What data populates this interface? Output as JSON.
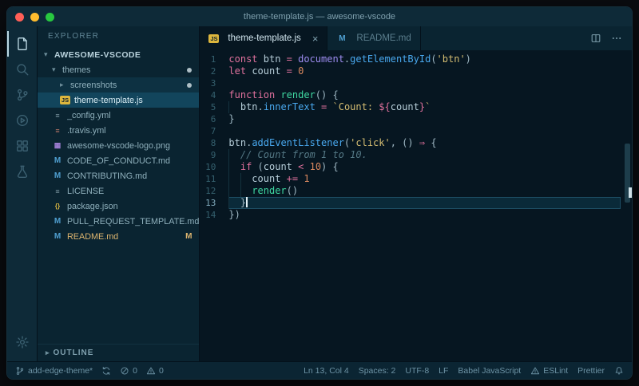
{
  "window": {
    "title": "theme-template.js — awesome-vscode",
    "traffic_lights": [
      "#ff5f57",
      "#febc2e",
      "#28c840"
    ]
  },
  "activity_bar": {
    "items": [
      {
        "name": "explorer",
        "active": true
      },
      {
        "name": "search"
      },
      {
        "name": "source-control"
      },
      {
        "name": "run"
      },
      {
        "name": "extensions"
      },
      {
        "name": "testing"
      }
    ],
    "bottom": [
      {
        "name": "settings"
      }
    ]
  },
  "sidebar": {
    "header": "EXPLORER",
    "outline_label": "OUTLINE",
    "tree": [
      {
        "label": "AWESOME-VSCODE",
        "indent": 0,
        "chevron": "down",
        "root": true
      },
      {
        "label": "themes",
        "indent": 1,
        "chevron": "down",
        "dot": true
      },
      {
        "label": "screenshots",
        "indent": 2,
        "chevron": "right",
        "dot": true,
        "state": "focused"
      },
      {
        "label": "theme-template.js",
        "indent": 2,
        "icon": "js",
        "state": "selected"
      },
      {
        "label": "_config.yml",
        "indent": 1,
        "icon": "yaml"
      },
      {
        "label": ".travis.yml",
        "indent": 1,
        "icon": "yaml",
        "icon_color": "#c07a6a"
      },
      {
        "label": "awesome-vscode-logo.png",
        "indent": 1,
        "icon": "image"
      },
      {
        "label": "CODE_OF_CONDUCT.md",
        "indent": 1,
        "icon": "md"
      },
      {
        "label": "CONTRIBUTING.md",
        "indent": 1,
        "icon": "md"
      },
      {
        "label": "LICENSE",
        "indent": 1,
        "icon": "file"
      },
      {
        "label": "package.json",
        "indent": 1,
        "icon": "json"
      },
      {
        "label": "PULL_REQUEST_TEMPLATE.md",
        "indent": 1,
        "icon": "md"
      },
      {
        "label": "README.md",
        "indent": 1,
        "icon": "md",
        "git": "M"
      }
    ]
  },
  "tabs": [
    {
      "label": "theme-template.js",
      "icon": "js",
      "active": true,
      "close_glyph": "×"
    },
    {
      "label": "README.md",
      "icon": "md",
      "active": false
    }
  ],
  "editor_actions": [
    {
      "name": "split-editor"
    },
    {
      "name": "more-actions"
    }
  ],
  "editor": {
    "active_line": 13,
    "lines": [
      {
        "n": 1,
        "guides": [],
        "segs": [
          [
            "kw",
            "const"
          ],
          [
            "pl",
            " btn "
          ],
          [
            "op",
            "="
          ],
          [
            "pl",
            " "
          ],
          [
            "obj",
            "document"
          ],
          [
            "pu",
            "."
          ],
          [
            "fn",
            "getElementById"
          ],
          [
            "pu",
            "("
          ],
          [
            "str",
            "'btn'"
          ],
          [
            "pu",
            ")"
          ]
        ]
      },
      {
        "n": 2,
        "guides": [],
        "segs": [
          [
            "kw",
            "let"
          ],
          [
            "pl",
            " count "
          ],
          [
            "op",
            "="
          ],
          [
            "pl",
            " "
          ],
          [
            "num",
            "0"
          ]
        ]
      },
      {
        "n": 3,
        "guides": [],
        "segs": []
      },
      {
        "n": 4,
        "guides": [],
        "segs": [
          [
            "kw",
            "function"
          ],
          [
            "pl",
            " "
          ],
          [
            "green",
            "render"
          ],
          [
            "pu",
            "() {"
          ]
        ]
      },
      {
        "n": 5,
        "guides": [
          0
        ],
        "segs": [
          [
            "pl",
            "  btn"
          ],
          [
            "pu",
            "."
          ],
          [
            "fn",
            "innerText"
          ],
          [
            "pl",
            " "
          ],
          [
            "op",
            "="
          ],
          [
            "pl",
            " "
          ],
          [
            "str",
            "`Count: "
          ],
          [
            "op",
            "${"
          ],
          [
            "pl",
            "count"
          ],
          [
            "op",
            "}"
          ],
          [
            "str",
            "`"
          ]
        ]
      },
      {
        "n": 6,
        "guides": [],
        "segs": [
          [
            "pu",
            "}"
          ]
        ]
      },
      {
        "n": 7,
        "guides": [],
        "segs": []
      },
      {
        "n": 8,
        "guides": [],
        "segs": [
          [
            "pl",
            "btn"
          ],
          [
            "pu",
            "."
          ],
          [
            "fn",
            "addEventListener"
          ],
          [
            "pu",
            "("
          ],
          [
            "str",
            "'click'"
          ],
          [
            "pu",
            ", () "
          ],
          [
            "op",
            "⇒"
          ],
          [
            "pu",
            " {"
          ]
        ]
      },
      {
        "n": 9,
        "guides": [
          0
        ],
        "segs": [
          [
            "pl",
            "  "
          ],
          [
            "cm",
            "// Count from 1 to 10."
          ]
        ]
      },
      {
        "n": 10,
        "guides": [
          0
        ],
        "segs": [
          [
            "pl",
            "  "
          ],
          [
            "kw",
            "if"
          ],
          [
            "pu",
            " ("
          ],
          [
            "pl",
            "count "
          ],
          [
            "op",
            "<"
          ],
          [
            "pl",
            " "
          ],
          [
            "num",
            "10"
          ],
          [
            "pu",
            ") {"
          ]
        ]
      },
      {
        "n": 11,
        "guides": [
          0,
          2
        ],
        "segs": [
          [
            "pl",
            "    count "
          ],
          [
            "op",
            "+="
          ],
          [
            "pl",
            " "
          ],
          [
            "num",
            "1"
          ]
        ]
      },
      {
        "n": 12,
        "guides": [
          0,
          2
        ],
        "segs": [
          [
            "pl",
            "    "
          ],
          [
            "green",
            "render"
          ],
          [
            "pu",
            "()"
          ]
        ]
      },
      {
        "n": 13,
        "guides": [
          0
        ],
        "cursor": true,
        "segs": [
          [
            "pl",
            "  "
          ],
          [
            "pu",
            "}"
          ]
        ]
      },
      {
        "n": 14,
        "guides": [],
        "segs": [
          [
            "pu",
            "})"
          ]
        ]
      }
    ]
  },
  "status_bar": {
    "left": [
      {
        "name": "git-branch",
        "icon": "branch",
        "label": "add-edge-theme*"
      },
      {
        "name": "sync",
        "icon": "sync",
        "label": ""
      },
      {
        "name": "problems-errors",
        "icon": "error",
        "label": "0"
      },
      {
        "name": "problems-warnings",
        "icon": "warning",
        "label": "0"
      }
    ],
    "right": [
      {
        "name": "cursor-position",
        "label": "Ln 13, Col 4"
      },
      {
        "name": "indentation",
        "label": "Spaces: 2"
      },
      {
        "name": "encoding",
        "label": "UTF-8"
      },
      {
        "name": "eol",
        "label": "LF"
      },
      {
        "name": "language-mode",
        "label": "Babel JavaScript"
      },
      {
        "name": "eslint",
        "icon": "warning",
        "label": "ESLint"
      },
      {
        "name": "prettier",
        "label": "Prettier"
      },
      {
        "name": "notifications",
        "icon": "bell",
        "label": ""
      }
    ]
  },
  "palette": {
    "chrome_bg": "#0e2a38",
    "panel_bg": "#0a2431",
    "editor_bg": "#061621",
    "status_bg": "#0b2533",
    "selection_bg": "#12455c",
    "keyword": "#e0719d",
    "string": "#d5bd72",
    "number": "#d9885f",
    "comment": "#547885",
    "method": "#49a8ee",
    "object": "#9d8cf0",
    "function_green": "#3fd8a2",
    "plain": "#b6cdd8",
    "punct": "#9fb8c4",
    "modified": "#ddb56f"
  }
}
